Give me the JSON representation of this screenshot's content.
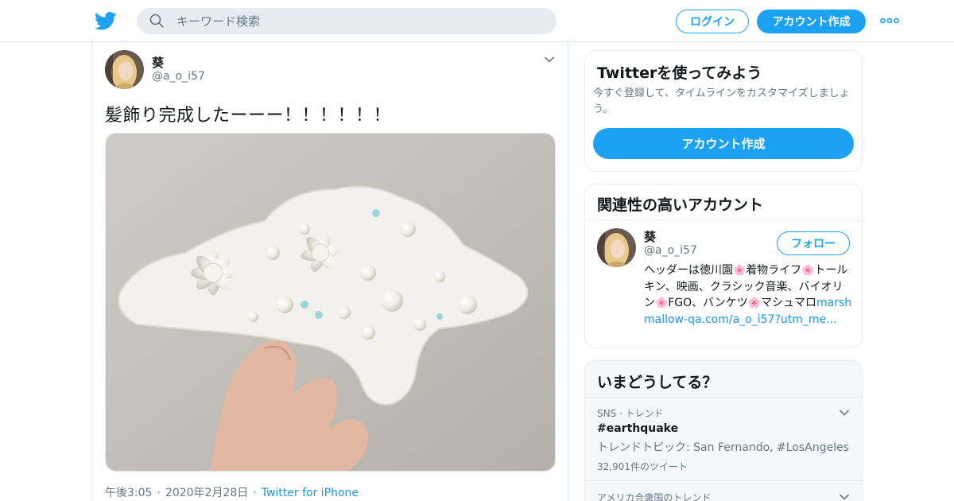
{
  "header": {
    "logo_icon": "twitter-bird-icon",
    "search_placeholder": "キーワード検索",
    "login_label": "ログイン",
    "signup_label": "アカウント作成",
    "more_icon": "more-dots-icon",
    "brand_color": "#1da1f2"
  },
  "tweet": {
    "name": "葵",
    "handle": "@a_o_i57",
    "text": "髪飾り完成したーーー！！！！！！",
    "time": "午後3:05",
    "date": "2020年2月28日",
    "source": "Twitter for iPhone",
    "media_icon": "photo-beaded-hair-ornament"
  },
  "sidebar": {
    "signup_card": {
      "title": "Twitterを使ってみよう",
      "description": "今すぐ登録して、タイムラインをカスタマイズしましょう。",
      "button_label": "アカウント作成"
    },
    "related_card": {
      "title": "関連性の高いアカウント",
      "name": "葵",
      "handle": "@a_o_i57",
      "follow_label": "フォロー",
      "bio_parts": [
        "ヘッダーは徳川園",
        "着物ライフ",
        "トールキン、映画、クラシック音楽、バイオリン",
        "FGO、バンケツ",
        "マシュマロ"
      ],
      "bio_link": "marshmallow-qa.com/a_o_i57?utm_me..."
    },
    "trends_card": {
      "title": "いまどうしてる？",
      "trends": [
        {
          "category": "SNS · トレンド",
          "name": "#earthquake",
          "description": "トレンドトピック: San Fernando, #LosAngeles",
          "count": "32,901件のツイート"
        },
        {
          "category": "アメリカ合衆国のトレンド"
        }
      ]
    }
  }
}
